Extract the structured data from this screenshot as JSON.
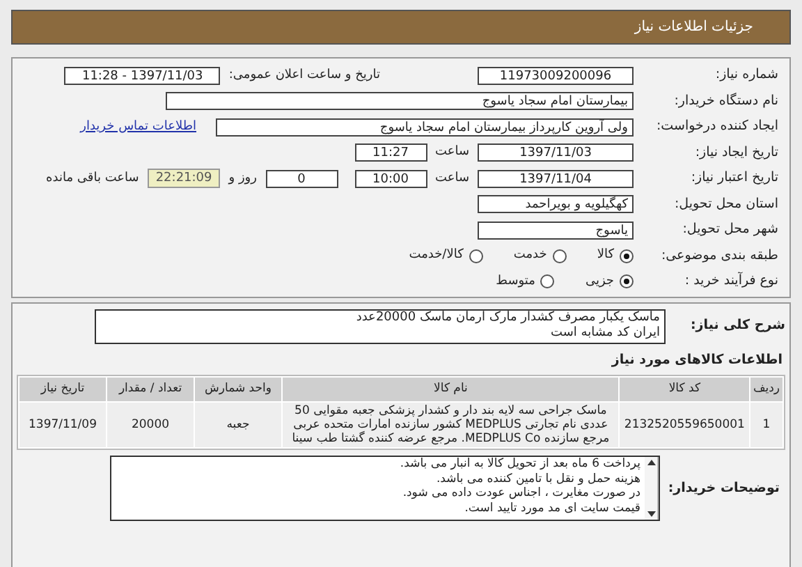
{
  "header": {
    "title": "جزئیات اطلاعات نیاز"
  },
  "need_number": {
    "label": "شماره نیاز:",
    "value": "11973009200096"
  },
  "announce": {
    "label": "تاریخ و ساعت اعلان عمومی:",
    "value": "1397/11/03 - 11:28"
  },
  "buyer_org": {
    "label": "نام دستگاه خریدار:",
    "value": "بیمارستان امام سجاد یاسوج"
  },
  "requester": {
    "label": "ایجاد کننده درخواست:",
    "value": "ولی آروین کارپرداز بیمارستان امام سجاد یاسوج",
    "link": "اطلاعات تماس خریدار"
  },
  "created": {
    "label": "تاریخ ایجاد نیاز:",
    "date": "1397/11/03",
    "time_label": "ساعت",
    "time": "11:27"
  },
  "validity": {
    "label": "تاریخ اعتبار نیاز:",
    "date": "1397/11/04",
    "time_label": "ساعت",
    "time": "10:00",
    "days": "0",
    "days_label": "روز و",
    "remaining": "22:21:09",
    "remaining_label": "ساعت باقی مانده"
  },
  "province": {
    "label": "استان محل تحویل:",
    "value": "کهگیلویه و بویراحمد"
  },
  "city": {
    "label": "شهر محل تحویل:",
    "value": "یاسوج"
  },
  "category": {
    "label": "طبقه بندی موضوعی:",
    "options": [
      {
        "label": "کالا",
        "selected": true
      },
      {
        "label": "خدمت",
        "selected": false
      },
      {
        "label": "کالا/خدمت",
        "selected": false
      }
    ]
  },
  "process": {
    "label": "نوع فرآیند خرید :",
    "options": [
      {
        "label": "جزیی",
        "selected": true
      },
      {
        "label": "متوسط",
        "selected": false
      }
    ]
  },
  "description": {
    "label": "شرح کلی نیاز:",
    "lines": [
      "ماسک یکبار مصرف کشدار مارک ارمان ماسک 20000عدد",
      "ایران کد مشابه است"
    ]
  },
  "goods": {
    "title": "اطلاعات کالاهای مورد نیاز",
    "columns": [
      "ردیف",
      "کد کالا",
      "نام کالا",
      "واحد شمارش",
      "تعداد / مقدار",
      "تاریخ نیاز"
    ],
    "rows": [
      [
        "1",
        "2132520559650001",
        "ماسک جراحی سه لایه بند دار و کشدار پزشکی جعبه مقوایی 50 عددی نام تجارتی MEDPLUS کشور سازنده امارات متحده عربی مرجع سازنده MEDPLUS Co. مرجع عرضه کننده گشتا طب سینا",
        "جعبه",
        "20000",
        "1397/11/09"
      ]
    ]
  },
  "notes": {
    "label": "توضیحات خریدار:",
    "lines": [
      "پرداخت 6 ماه بعد از تحویل کالا به انبار می باشد.",
      "هزینه حمل و نقل با تامین کننده می باشد.",
      "در صورت مغایرت ، اجناس عودت داده می شود.",
      "قیمت سایت ای مد مورد تایید است."
    ]
  }
}
